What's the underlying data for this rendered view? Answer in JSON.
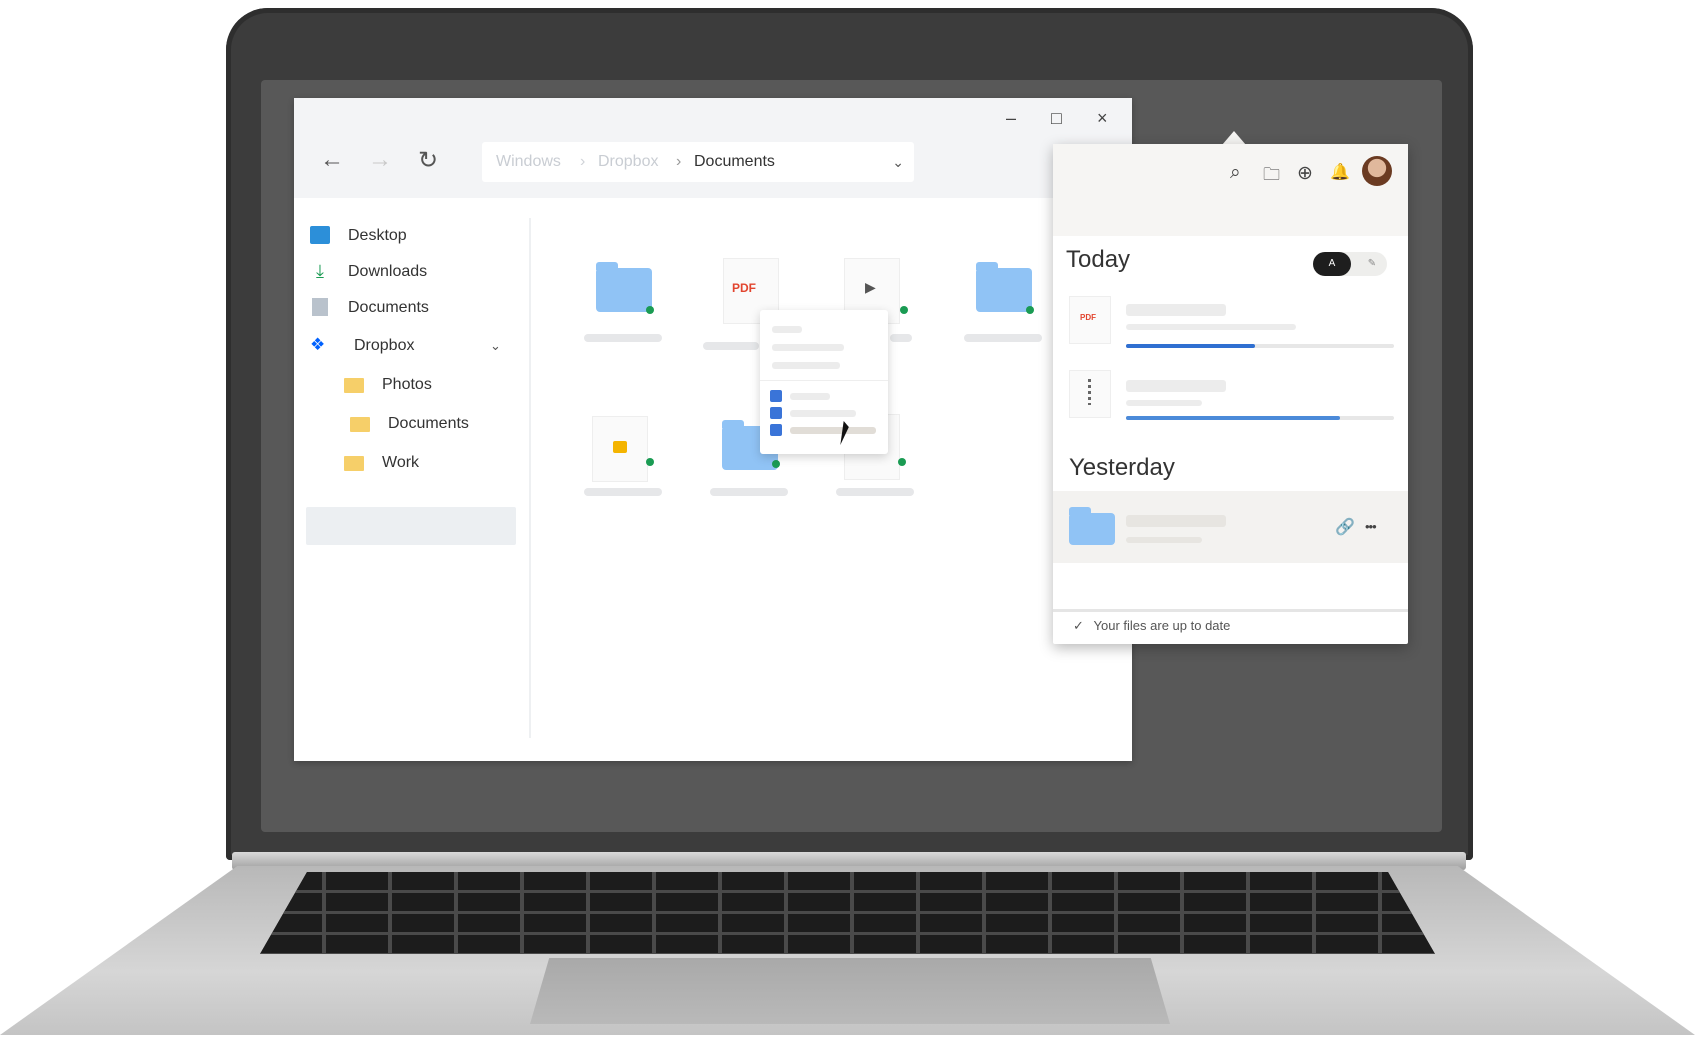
{
  "explorer": {
    "window_controls": {
      "minimize": "–",
      "maximize": "□",
      "close": "×"
    },
    "nav": {
      "back": "←",
      "forward": "→",
      "refresh": "↻"
    },
    "breadcrumb": [
      "Windows",
      "Dropbox",
      "Documents"
    ],
    "separator": "›",
    "dropdown_icon": "⌄",
    "sidebar": {
      "items": [
        {
          "label": "Desktop",
          "icon": "desktop-icon"
        },
        {
          "label": "Downloads",
          "icon": "download-icon"
        },
        {
          "label": "Documents",
          "icon": "documents-icon"
        },
        {
          "label": "Dropbox",
          "icon": "dropbox-icon",
          "expanded": true
        },
        {
          "label": "Photos",
          "icon": "folder-icon"
        },
        {
          "label": "Documents",
          "icon": "folder-icon",
          "selected": true
        },
        {
          "label": "Work",
          "icon": "folder-icon"
        }
      ],
      "expand_icon": "⌄"
    },
    "files": {
      "pdf_label": "PDF",
      "play_glyph": "▶"
    }
  },
  "dropbox_panel": {
    "header_icons": [
      "search-icon",
      "folder-icon",
      "globe-icon",
      "bell-icon",
      "avatar"
    ],
    "header_glyphs": {
      "search": "⌕",
      "folder": "🗀",
      "globe": "⊕",
      "bell": "🔔"
    },
    "today_label": "Today",
    "toggle": {
      "on": "A",
      "off": "✎"
    },
    "today_items": [
      {
        "kind": "pdf",
        "label": "PDF",
        "progress": 0.48
      },
      {
        "kind": "zip",
        "label": "ZIP",
        "progress": 0.8
      }
    ],
    "yesterday_label": "Yesterday",
    "yesterday_actions": {
      "link": "🔗",
      "more": "•••"
    },
    "status_check": "✓",
    "status_text": "Your files are up to date"
  },
  "colors": {
    "accent_blue": "#2f6fd1",
    "folder_blue": "#90c3f5",
    "folder_yellow": "#f6cf69",
    "sync_green": "#1a9b53",
    "dropbox_blue": "#0061fe"
  }
}
